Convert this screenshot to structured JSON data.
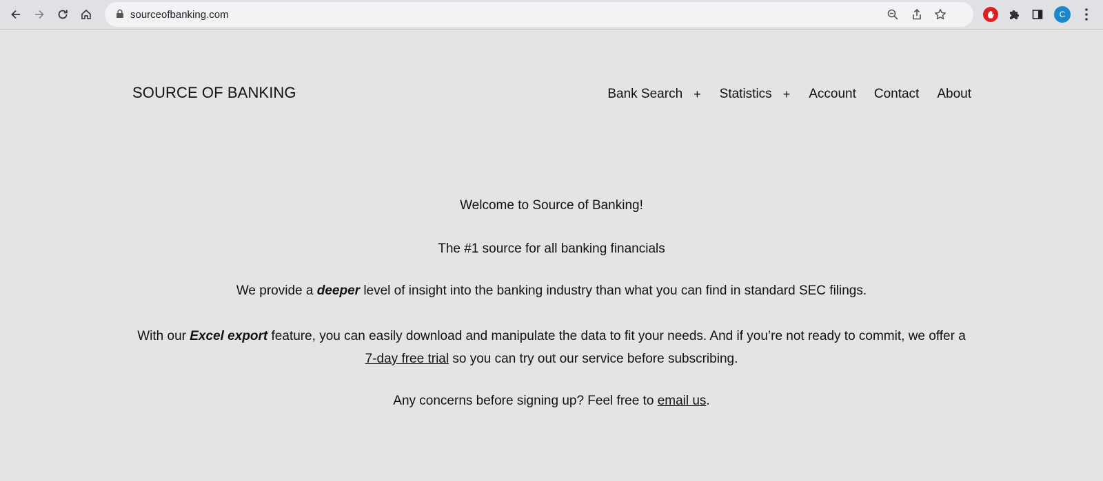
{
  "browser": {
    "url": "sourceofbanking.com",
    "avatar_letter": "C"
  },
  "site": {
    "title": "SOURCE OF BANKING"
  },
  "nav": {
    "bank_search": "Bank Search",
    "bank_search_expand": "+",
    "statistics": "Statistics",
    "statistics_expand": "+",
    "account": "Account",
    "contact": "Contact",
    "about": "About"
  },
  "main": {
    "welcome": "Welcome to Source of Banking!",
    "tagline": "The #1 source for all banking financials",
    "p3_pre": "We provide a ",
    "p3_em": "deeper",
    "p3_post": " level of insight into the banking industry than what you can find in standard SEC filings.",
    "p4_pre": "With our ",
    "p4_em": "Excel export",
    "p4_mid": " feature, you can easily download and manipulate the data to fit your needs. And if you’re not ready to commit, we offer a ",
    "p4_link": "7-day free trial",
    "p4_post": " so you can try out our service before subscribing.",
    "p5_pre": "Any concerns before signing up? Feel free to ",
    "p5_link": "email us",
    "p5_post": "."
  }
}
